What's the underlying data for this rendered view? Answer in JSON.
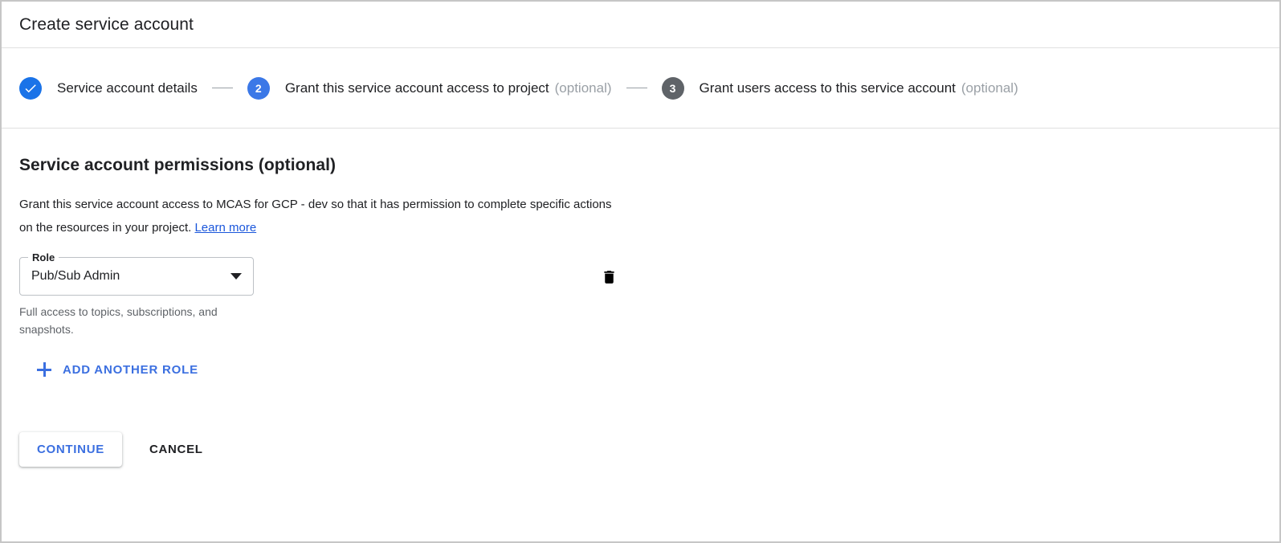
{
  "header": {
    "title": "Create service account"
  },
  "stepper": {
    "steps": [
      {
        "badge": "check",
        "state": "done",
        "label": "Service account details",
        "optional": ""
      },
      {
        "badge": "2",
        "state": "active",
        "label": "Grant this service account access to project",
        "optional": "(optional)"
      },
      {
        "badge": "3",
        "state": "inactive",
        "label": "Grant users access to this service account",
        "optional": "(optional)"
      }
    ]
  },
  "main": {
    "section_title": "Service account permissions (optional)",
    "description_part1": "Grant this service account access to MCAS for GCP - dev so that it has permission to complete specific actions on the resources in your project.",
    "learn_more_label": "Learn more",
    "role": {
      "label": "Role",
      "value": "Pub/Sub Admin",
      "helper_text": "Full access to topics, subscriptions, and snapshots.",
      "delete_icon": "trash-icon",
      "dropdown_icon": "chevron-down-icon"
    },
    "add_role": {
      "icon": "plus-icon",
      "label": "ADD ANOTHER ROLE"
    }
  },
  "actions": {
    "continue_label": "CONTINUE",
    "cancel_label": "CANCEL"
  },
  "colors": {
    "accent_blue": "#1a73e8",
    "link_blue": "#1a56db",
    "button_blue": "#3b6fe0",
    "inactive_gray": "#5f6368",
    "optional_gray": "#9aa0a6",
    "border_gray": "#e0e0e0"
  }
}
